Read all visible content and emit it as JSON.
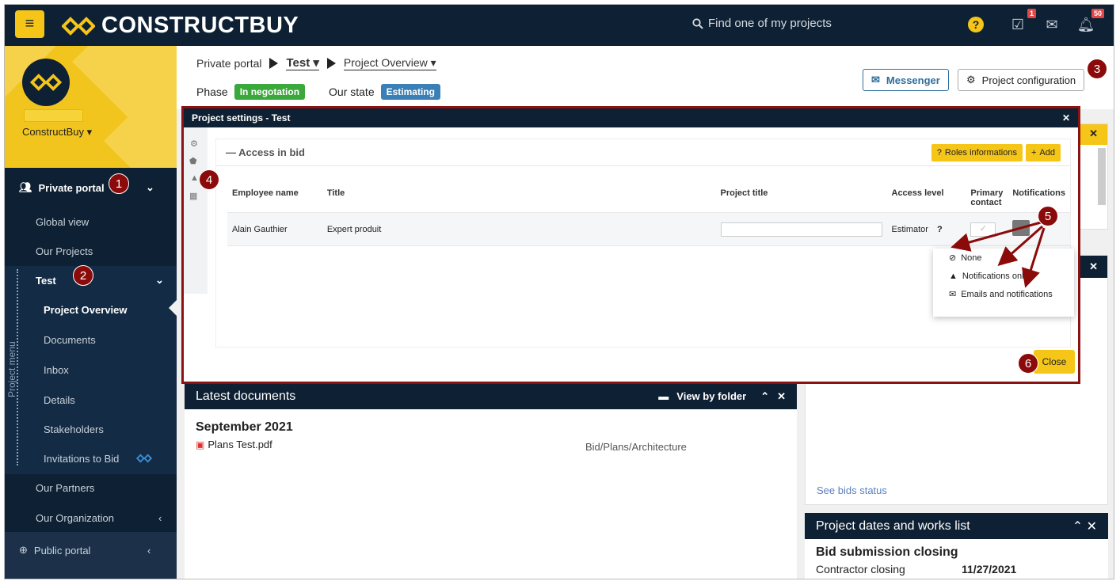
{
  "app": {
    "name": "CONSTRUCTBUY"
  },
  "search": {
    "placeholder": "Find one of my projects"
  },
  "topbar": {
    "calendar_badge": "1",
    "notifications_badge": "50"
  },
  "sidebar": {
    "brand": "ConstructBuy",
    "items": {
      "private_portal": "Private portal",
      "global_view": "Global view",
      "our_projects": "Our Projects",
      "test": "Test",
      "project_overview": "Project Overview",
      "documents": "Documents",
      "inbox": "Inbox",
      "details": "Details",
      "stakeholders": "Stakeholders",
      "invitations": "Invitations to Bid",
      "our_partners": "Our Partners",
      "our_organization": "Our Organization",
      "public_portal": "Public portal"
    },
    "project_menu_label": "Project menu"
  },
  "breadcrumb": {
    "root": "Private portal",
    "project": "Test",
    "page": "Project Overview"
  },
  "status": {
    "phase_label": "Phase",
    "phase_value": "In negotation",
    "state_label": "Our state",
    "state_value": "Estimating",
    "phase_color": "#3aa83a",
    "state_color": "#3a7fb6"
  },
  "buttons": {
    "messenger": "Messenger",
    "project_config": "Project configuration"
  },
  "modal": {
    "title": "Project settings - Test",
    "section_title": "Access in bid",
    "roles_btn": "Roles informations",
    "add_btn": "Add",
    "columns": {
      "employee": "Employee name",
      "title": "Title",
      "project_title": "Project title",
      "access": "Access level",
      "primary": "Primary contact",
      "notifications": "Notifications"
    },
    "row": {
      "employee": "Alain Gauthier",
      "title": "Expert produit",
      "project_title": "",
      "access": "Estimator"
    },
    "dropdown": [
      "None",
      "Notifications only",
      "Emails and notifications"
    ],
    "close": "Close"
  },
  "latest_docs": {
    "title": "Latest documents",
    "view_by_folder": "View by folder",
    "month": "September 2021",
    "file_name": "Plans Test.pdf",
    "file_path": "Bid/Plans/Architecture"
  },
  "bids": {
    "see_status": "See bids status"
  },
  "project_dates": {
    "title": "Project dates and works list",
    "heading": "Bid submission closing",
    "label": "Contractor closing",
    "date": "11/27/2021"
  },
  "callouts": [
    "1",
    "2",
    "3",
    "4",
    "5",
    "6"
  ],
  "colors": {
    "navy": "#0e2033",
    "yellow": "#f5c518",
    "callout": "#8b0a0a"
  }
}
